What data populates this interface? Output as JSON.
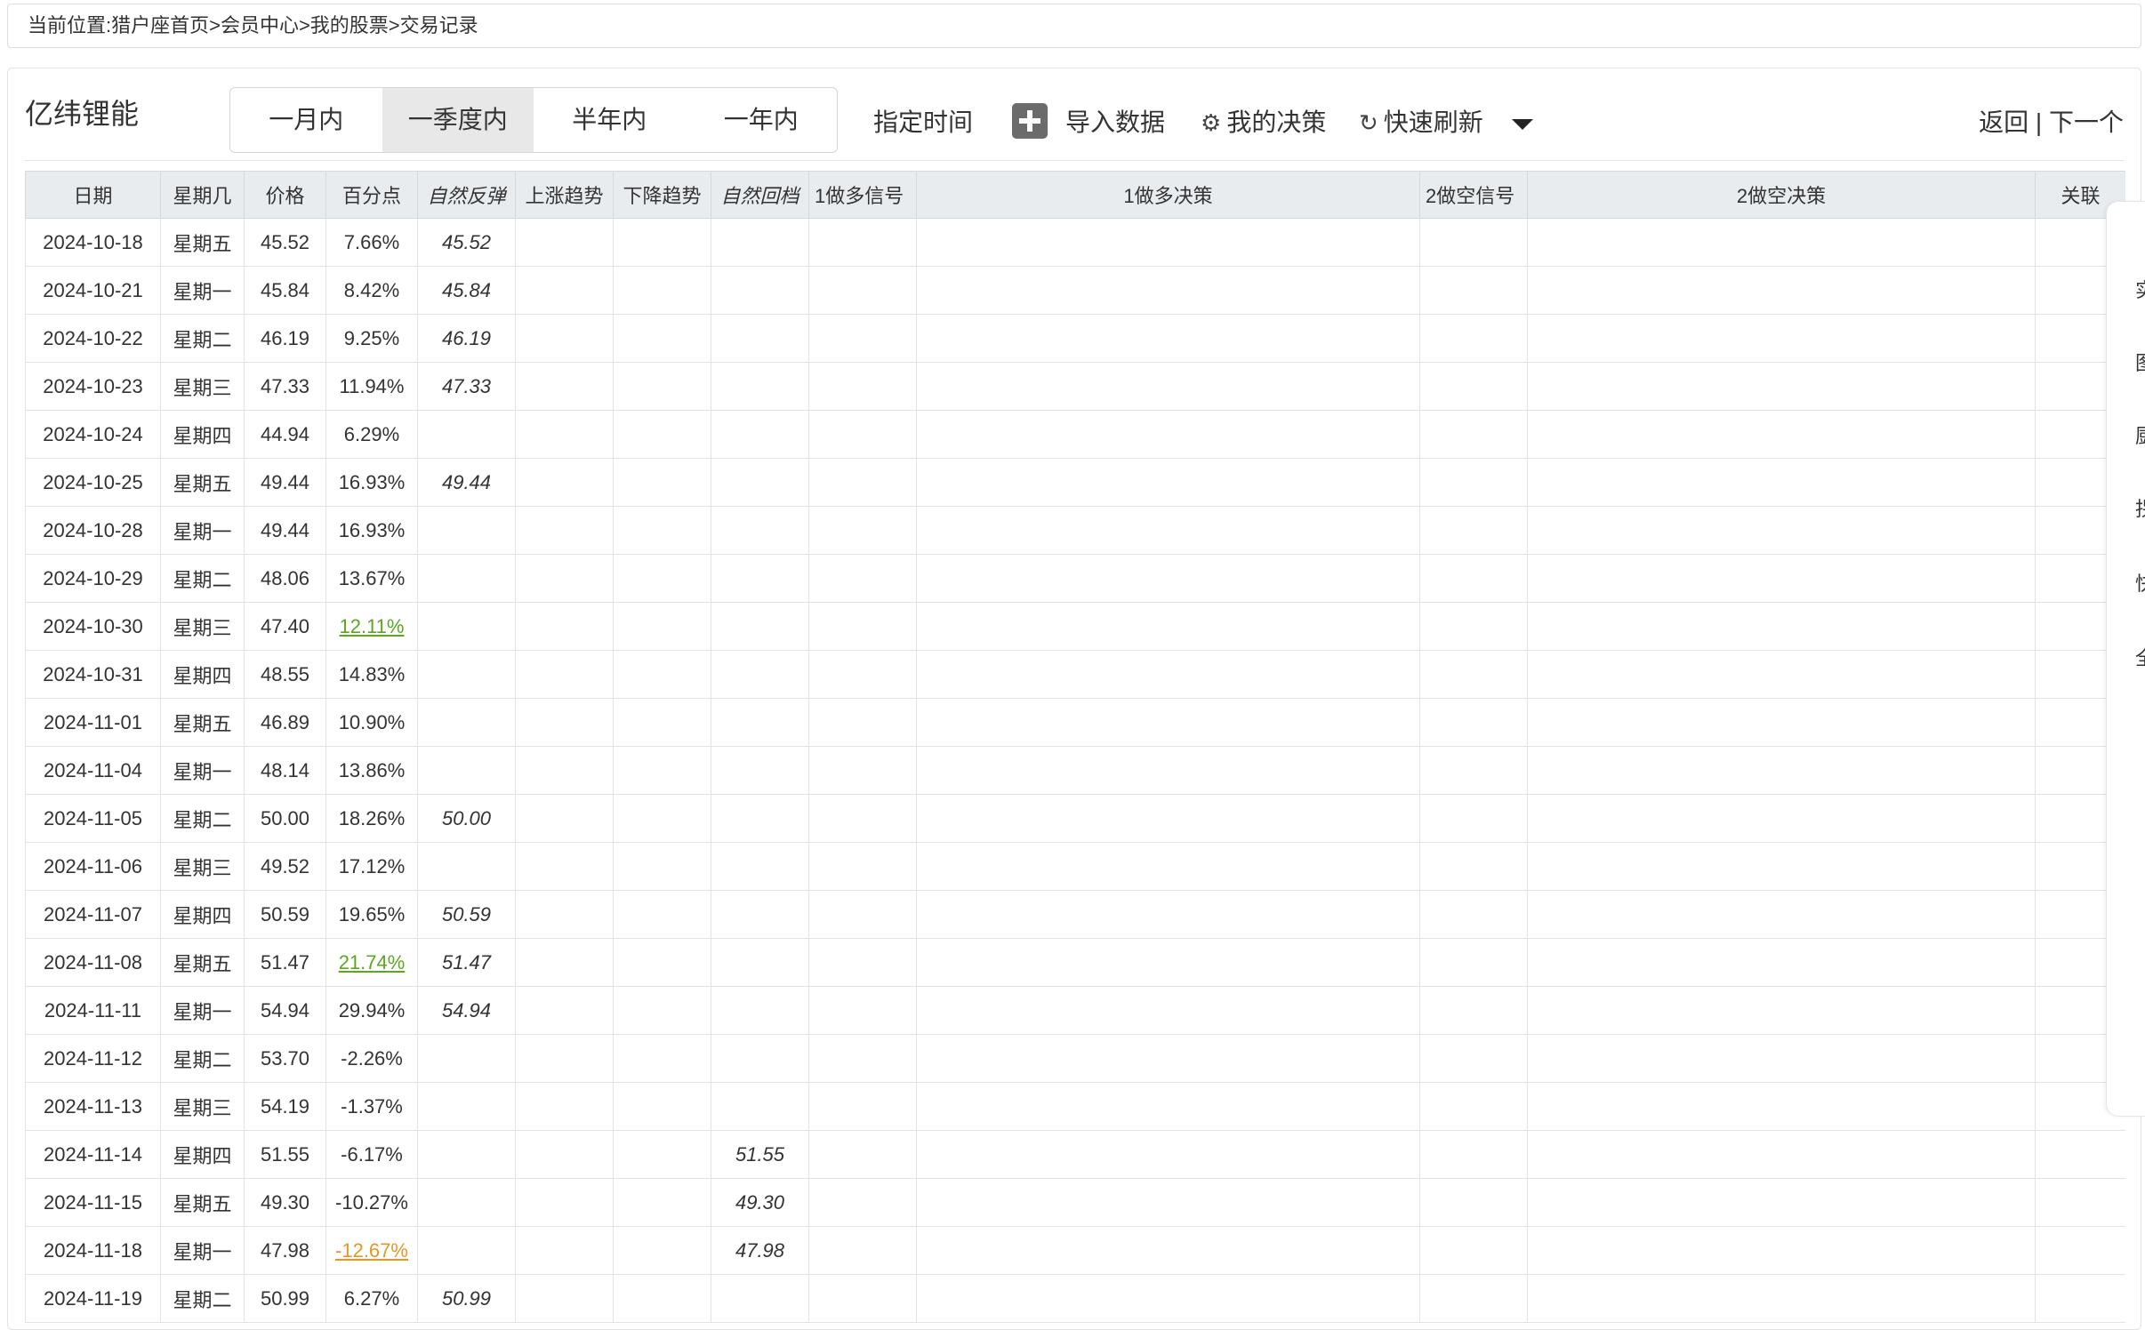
{
  "breadcrumb": "当前位置:猎户座首页>会员中心>我的股票>交易记录",
  "stock_name": "亿纬锂能",
  "period_tabs": [
    {
      "label": "一月内",
      "active": false
    },
    {
      "label": "一季度内",
      "active": true
    },
    {
      "label": "半年内",
      "active": false
    },
    {
      "label": "一年内",
      "active": false
    }
  ],
  "toolbar": {
    "specify_time": "指定时间",
    "import_data": "导入数据",
    "my_decision": "我的决策",
    "quick_refresh": "快速刷新",
    "back": "返回",
    "separator": "|",
    "next": "下一个"
  },
  "icons": {
    "import": "plus-square-icon",
    "decision": "gear-icon",
    "refresh": "refresh-icon",
    "dropdown": "caret-down-icon"
  },
  "colors": {
    "rebound_text": "#1a1aff",
    "downtrend_header": "#e0281e",
    "highlight_green": "#5aa81e",
    "highlight_orange": "#e8961e",
    "marker_black": "#111111",
    "marker_red": "#e0281e"
  },
  "table": {
    "headers": {
      "date": "日期",
      "weekday": "星期几",
      "price": "价格",
      "percent": "百分点",
      "natural_rebound": "自然反弹",
      "uptrend": "上涨趋势",
      "downtrend": "下降趋势",
      "natural_pullback": "自然回档",
      "long1_signal": "1做多信号",
      "long1_decision": "1做多决策",
      "short2_signal": "2做空信号",
      "short2_decision": "2做空决策",
      "related": "关联"
    },
    "rows": [
      {
        "date": "2024-10-18",
        "weekday": "星期五",
        "price": "45.52",
        "pct": "7.66%",
        "rebound": "45.52",
        "pullback": ""
      },
      {
        "date": "2024-10-21",
        "weekday": "星期一",
        "price": "45.84",
        "pct": "8.42%",
        "rebound": "45.84",
        "pullback": ""
      },
      {
        "date": "2024-10-22",
        "weekday": "星期二",
        "price": "46.19",
        "pct": "9.25%",
        "rebound": "46.19",
        "pullback": ""
      },
      {
        "date": "2024-10-23",
        "weekday": "星期三",
        "price": "47.33",
        "pct": "11.94%",
        "rebound": "47.33",
        "pullback": ""
      },
      {
        "date": "2024-10-24",
        "weekday": "星期四",
        "price": "44.94",
        "pct": "6.29%",
        "rebound": "",
        "pullback": ""
      },
      {
        "date": "2024-10-25",
        "weekday": "星期五",
        "price": "49.44",
        "pct": "16.93%",
        "rebound": "49.44",
        "pullback": ""
      },
      {
        "date": "2024-10-28",
        "weekday": "星期一",
        "price": "49.44",
        "pct": "16.93%",
        "rebound": "",
        "pullback": ""
      },
      {
        "date": "2024-10-29",
        "weekday": "星期二",
        "price": "48.06",
        "pct": "13.67%",
        "rebound": "",
        "pullback": ""
      },
      {
        "date": "2024-10-30",
        "weekday": "星期三",
        "price": "47.40",
        "pct": "12.11%",
        "pct_style": "green",
        "rebound": "",
        "pullback": ""
      },
      {
        "date": "2024-10-31",
        "weekday": "星期四",
        "price": "48.55",
        "pct": "14.83%",
        "rebound": "",
        "pullback": ""
      },
      {
        "date": "2024-11-01",
        "weekday": "星期五",
        "price": "46.89",
        "pct": "10.90%",
        "rebound": "",
        "pullback": ""
      },
      {
        "date": "2024-11-04",
        "weekday": "星期一",
        "price": "48.14",
        "pct": "13.86%",
        "rebound": "",
        "pullback": ""
      },
      {
        "date": "2024-11-05",
        "weekday": "星期二",
        "price": "50.00",
        "pct": "18.26%",
        "rebound": "50.00",
        "pullback": ""
      },
      {
        "date": "2024-11-06",
        "weekday": "星期三",
        "price": "49.52",
        "pct": "17.12%",
        "rebound": "",
        "pullback": ""
      },
      {
        "date": "2024-11-07",
        "weekday": "星期四",
        "price": "50.59",
        "pct": "19.65%",
        "rebound": "50.59",
        "pullback": ""
      },
      {
        "date": "2024-11-08",
        "weekday": "星期五",
        "price": "51.47",
        "pct": "21.74%",
        "pct_style": "green",
        "rebound": "51.47",
        "pullback": ""
      },
      {
        "date": "2024-11-11",
        "weekday": "星期一",
        "price": "54.94",
        "pct": "29.94%",
        "rebound": "54.94",
        "rebound_mark": "black",
        "pullback": ""
      },
      {
        "date": "2024-11-12",
        "weekday": "星期二",
        "price": "53.70",
        "pct": "-2.26%",
        "rebound": "",
        "pullback": ""
      },
      {
        "date": "2024-11-13",
        "weekday": "星期三",
        "price": "54.19",
        "pct": "-1.37%",
        "rebound": "",
        "pullback": ""
      },
      {
        "date": "2024-11-14",
        "weekday": "星期四",
        "price": "51.55",
        "pct": "-6.17%",
        "rebound": "",
        "pullback": "51.55"
      },
      {
        "date": "2024-11-15",
        "weekday": "星期五",
        "price": "49.30",
        "pct": "-10.27%",
        "rebound": "",
        "pullback": "49.30"
      },
      {
        "date": "2024-11-18",
        "weekday": "星期一",
        "price": "47.98",
        "pct": "-12.67%",
        "pct_style": "orange",
        "rebound": "",
        "pullback": "47.98",
        "pullback_mark": "red"
      },
      {
        "date": "2024-11-19",
        "weekday": "星期二",
        "price": "50.99",
        "pct": "6.27%",
        "rebound": "50.99",
        "rebound_mark": "black",
        "pullback": ""
      }
    ]
  },
  "side_panel": {
    "chars": [
      "实",
      "图",
      "厨",
      "拐",
      "快",
      "全"
    ]
  }
}
